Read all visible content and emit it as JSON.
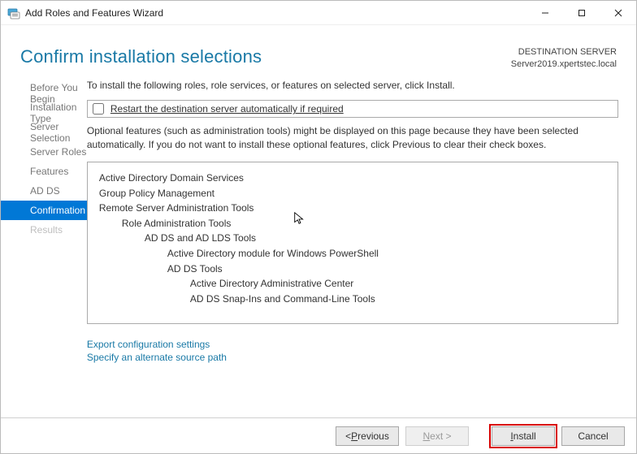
{
  "titlebar": {
    "title": "Add Roles and Features Wizard"
  },
  "header": {
    "page_title": "Confirm installation selections",
    "dest_label": "DESTINATION SERVER",
    "dest_server": "Server2019.xpertstec.local"
  },
  "sidebar": {
    "steps": [
      "Before You Begin",
      "Installation Type",
      "Server Selection",
      "Server Roles",
      "Features",
      "AD DS",
      "Confirmation",
      "Results"
    ],
    "selected_index": 6,
    "disabled_indexes": [
      7
    ]
  },
  "main": {
    "intro": "To install the following roles, role services, or features on selected server, click Install.",
    "restart_label": "Restart the destination server automatically if required",
    "restart_checked": false,
    "note": "Optional features (such as administration tools) might be displayed on this page because they have been selected automatically. If you do not want to install these optional features, click Previous to clear their check boxes.",
    "features": [
      {
        "indent": 0,
        "text": "Active Directory Domain Services"
      },
      {
        "indent": 0,
        "text": "Group Policy Management"
      },
      {
        "indent": 0,
        "text": "Remote Server Administration Tools"
      },
      {
        "indent": 1,
        "text": "Role Administration Tools"
      },
      {
        "indent": 2,
        "text": "AD DS and AD LDS Tools"
      },
      {
        "indent": 3,
        "text": "Active Directory module for Windows PowerShell"
      },
      {
        "indent": 3,
        "text": "AD DS Tools"
      },
      {
        "indent": 4,
        "text": "Active Directory Administrative Center"
      },
      {
        "indent": 4,
        "text": "AD DS Snap-Ins and Command-Line Tools"
      }
    ],
    "links": {
      "export": "Export configuration settings",
      "altsource": "Specify an alternate source path"
    }
  },
  "footer": {
    "prev_prefix": "< ",
    "prev_u": "P",
    "prev_rest": "revious",
    "next_u": "N",
    "next_rest": "ext >",
    "install_u": "I",
    "install_rest": "nstall",
    "cancel": "Cancel"
  }
}
